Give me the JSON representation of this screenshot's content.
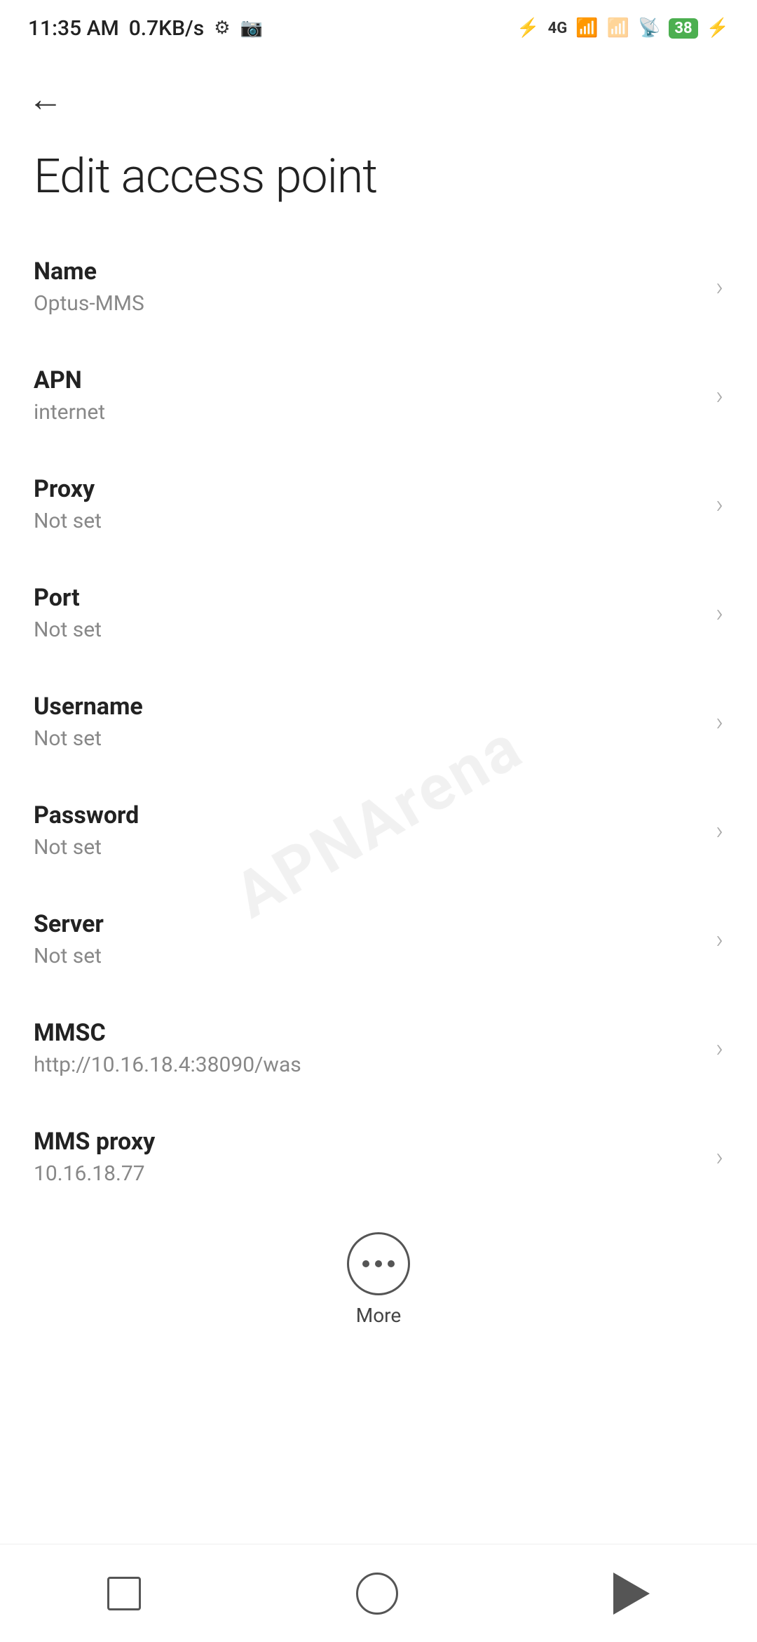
{
  "status_bar": {
    "time": "11:35 AM",
    "network_speed": "0.7KB/s"
  },
  "page": {
    "title": "Edit access point"
  },
  "settings_items": [
    {
      "label": "Name",
      "value": "Optus-MMS"
    },
    {
      "label": "APN",
      "value": "internet"
    },
    {
      "label": "Proxy",
      "value": "Not set"
    },
    {
      "label": "Port",
      "value": "Not set"
    },
    {
      "label": "Username",
      "value": "Not set"
    },
    {
      "label": "Password",
      "value": "Not set"
    },
    {
      "label": "Server",
      "value": "Not set"
    },
    {
      "label": "MMSC",
      "value": "http://10.16.18.4:38090/was"
    },
    {
      "label": "MMS proxy",
      "value": "10.16.18.77"
    }
  ],
  "more_button": {
    "label": "More"
  },
  "watermark": "APNArena"
}
